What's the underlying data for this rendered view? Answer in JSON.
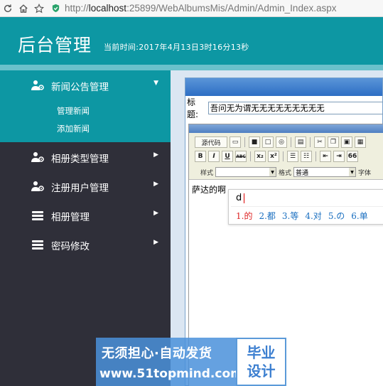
{
  "browser": {
    "url_scheme": "http://",
    "url_host": "localhost",
    "url_rest": ":25899/WebAlbumsMis/Admin/Admin_Index.aspx"
  },
  "header": {
    "title": "后台管理",
    "time_label": "当前时间:2017年4月13日3时16分13秒"
  },
  "sidebar": {
    "items": [
      {
        "label": "新闻公告管理",
        "icon": "user-gear-icon",
        "expanded": true,
        "children": [
          {
            "label": "管理新闻"
          },
          {
            "label": "添加新闻"
          }
        ]
      },
      {
        "label": "相册类型管理",
        "icon": "user-gear-icon"
      },
      {
        "label": "注册用户管理",
        "icon": "user-gear-icon"
      },
      {
        "label": "相册管理",
        "icon": "stack-icon"
      },
      {
        "label": "密码修改",
        "icon": "stack-icon"
      }
    ]
  },
  "form": {
    "title_label": "标题:",
    "title_value": "吾问无为谓无无无无无无无无无"
  },
  "editor": {
    "toolbar": {
      "source_label": "源代码",
      "style_label": "样式",
      "format_label": "格式",
      "format_value": "普通",
      "font_label": "字体",
      "bold": "B",
      "italic": "I",
      "underline": "U",
      "strike": "ABC",
      "subscript": "x₂",
      "superscript": "x²",
      "quote": "66"
    },
    "content": "萨达的啊",
    "ime": {
      "input": "d",
      "candidates": [
        "1.的",
        "2.都",
        "3.等",
        "4.对",
        "5.の",
        "6.单"
      ]
    }
  },
  "watermark": {
    "line1": "无须担心·自动发货",
    "line2": "www.51topmind.com",
    "badge_line1": "毕业",
    "badge_line2": "设计"
  },
  "colors": {
    "header": "#0d97a3",
    "sidebar": "#2f2f39",
    "active": "#0d97a3"
  }
}
